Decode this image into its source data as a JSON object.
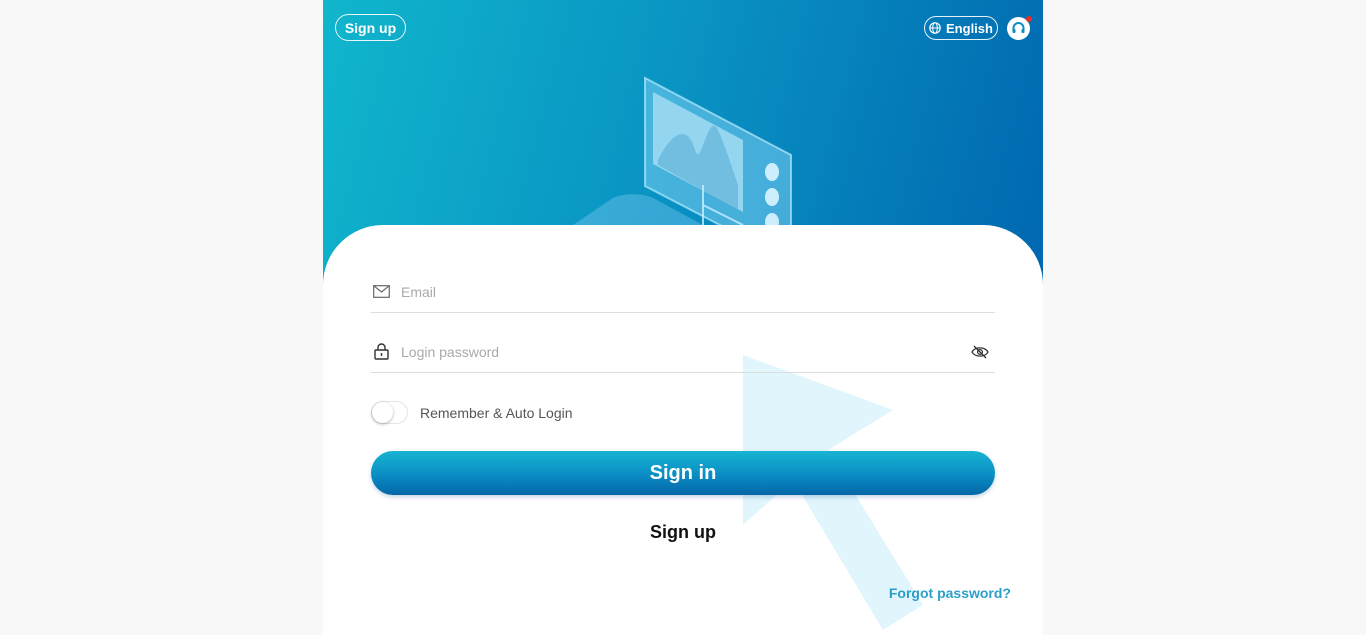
{
  "header": {
    "signup_label": "Sign up",
    "language_label": "English"
  },
  "form": {
    "email": {
      "placeholder": "Email",
      "value": ""
    },
    "password": {
      "placeholder": "Login password",
      "value": ""
    },
    "remember_label": "Remember & Auto Login",
    "remember_on": false,
    "signin_label": "Sign in",
    "signup_label": "Sign up",
    "forgot_label": "Forgot password?"
  },
  "icons": {
    "email": "mail-icon",
    "password": "lock-icon",
    "visibility": "eye-off-icon",
    "language": "globe-icon",
    "support": "headset-icon"
  },
  "colors": {
    "brand_gradient_start": "#10b6cc",
    "brand_gradient_end": "#0067b0",
    "link": "#2b9fc9",
    "notification_dot": "#e0302a"
  }
}
